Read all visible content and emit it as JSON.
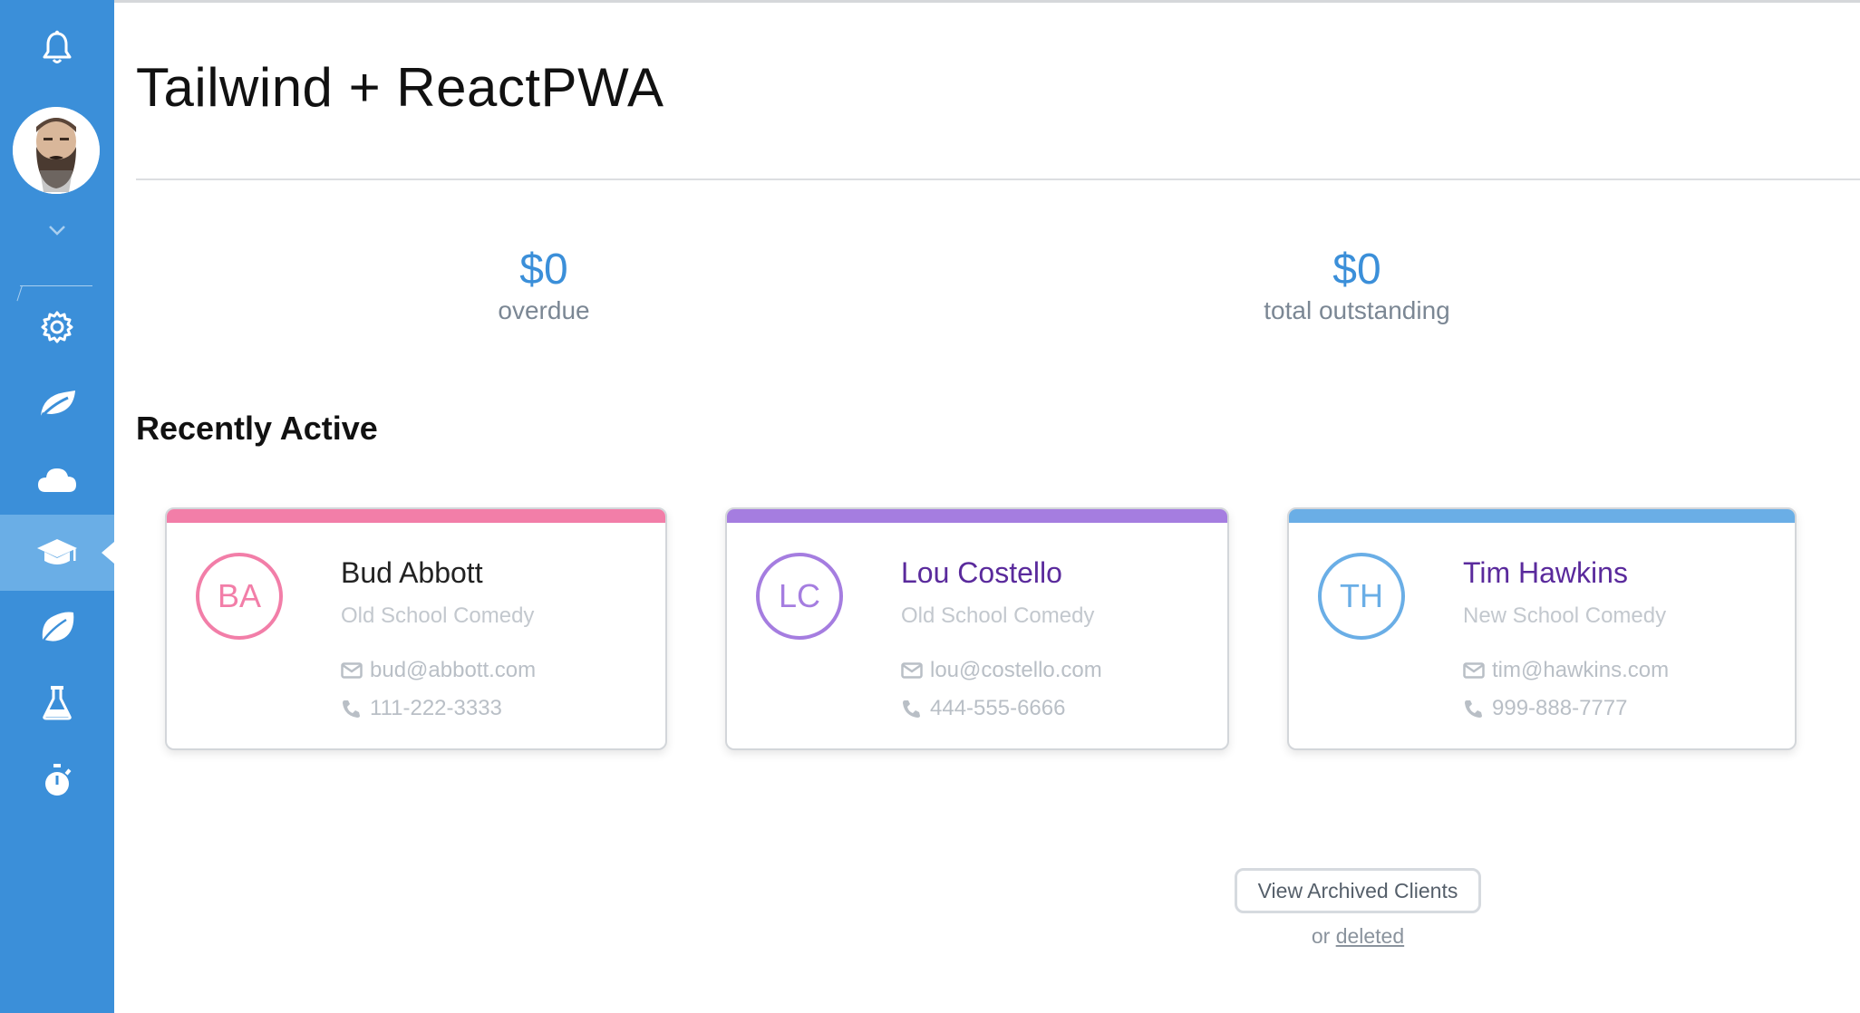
{
  "app": {
    "title": "Tailwind + ReactPWA"
  },
  "sidebar": {
    "icons": [
      "bell-icon",
      "chevron-down-icon",
      "gear-icon",
      "leaf-icon",
      "cloud-icon",
      "graduation-cap-icon",
      "leaf-alt-icon",
      "flask-icon",
      "stopwatch-icon"
    ],
    "active": "graduation-cap-icon",
    "background": "#3b8fd9"
  },
  "stats": {
    "overdue": {
      "value": "$0",
      "label": "overdue"
    },
    "outstanding": {
      "value": "$0",
      "label": "total outstanding"
    }
  },
  "recent": {
    "heading": "Recently Active",
    "clients": [
      {
        "initials": "BA",
        "name": "Bud Abbott",
        "group": "Old School Comedy",
        "email": "bud@abbott.com",
        "phone": "111-222-3333",
        "color": "#f27ea8",
        "name_color": "#222222"
      },
      {
        "initials": "LC",
        "name": "Lou Costello",
        "group": "Old School Comedy",
        "email": "lou@costello.com",
        "phone": "444-555-6666",
        "color": "#a57de0",
        "name_color": "#5a2a9c"
      },
      {
        "initials": "TH",
        "name": "Tim Hawkins",
        "group": "New School Comedy",
        "email": "tim@hawkins.com",
        "phone": "999-888-7777",
        "color": "#6aaee6",
        "name_color": "#5a2a9c"
      }
    ]
  },
  "archive": {
    "button_label": "View Archived Clients",
    "or_text": "or",
    "deleted_link": "deleted"
  }
}
